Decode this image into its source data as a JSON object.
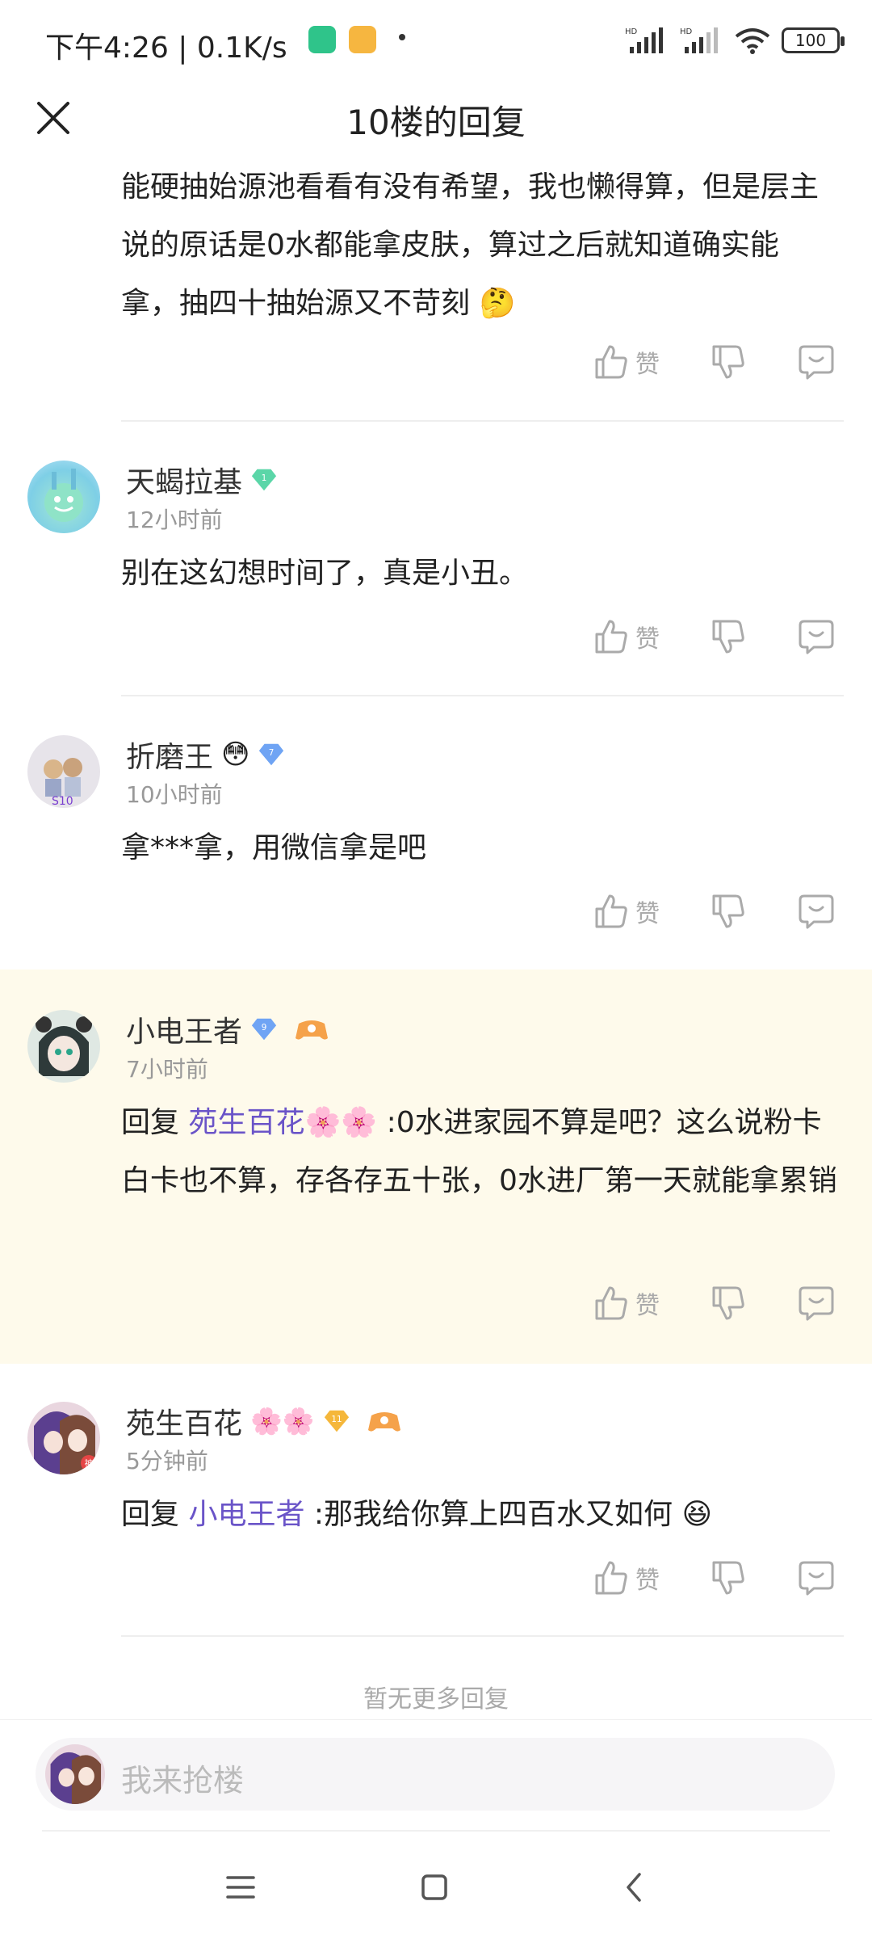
{
  "status_bar": {
    "time": "下午4:26 | 0.1K/s",
    "battery": "100"
  },
  "header": {
    "title": "10楼的回复"
  },
  "continuation_text": "能硬抽始源池看看有没有希望，我也懒得算，但是层主说的原话是0水都能拿皮肤，算过之后就知道确实能拿，抽四十抽始源又不苛刻",
  "action_labels": {
    "like": "赞"
  },
  "comments": [
    {
      "username": "天蝎拉基",
      "level": "1",
      "time": "12小时前",
      "text": "别在这幻想时间了，真是小丑。"
    },
    {
      "username": "折磨王",
      "level": "7",
      "time": "10小时前",
      "text": "拿***拿，用微信拿是吧"
    },
    {
      "username": "小电王者",
      "level": "9",
      "time": "7小时前",
      "reply_prefix": "回复",
      "mention": "苑生百花",
      "text": " :0水进家园不算是吧？这么说粉卡白卡也不算，存各存五十张，0水进厂第一天就能拿累销"
    },
    {
      "username": "苑生百花",
      "level": "11",
      "time": "5分钟前",
      "reply_prefix": "回复",
      "mention": "小电王者",
      "text": " :那我给你算上四百水又如何"
    }
  ],
  "footer": {
    "no_more": "暂无更多回复",
    "input_placeholder": "我来抢楼"
  },
  "colors": {
    "highlight_bg": "#fefaeb",
    "mention": "#6a54c8",
    "badge_green": "#5bd6a8",
    "badge_blue": "#6fa4f4",
    "badge_gold": "#f5b73b"
  }
}
